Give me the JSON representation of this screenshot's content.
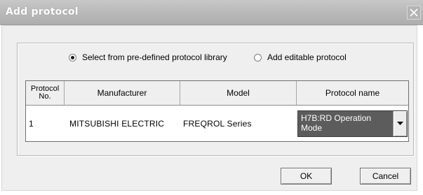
{
  "window": {
    "title": "Add protocol"
  },
  "options": {
    "predefined_label": "Select from pre-defined protocol library",
    "predefined_checked": true,
    "editable_label": "Add editable protocol",
    "editable_checked": false
  },
  "table": {
    "headers": {
      "protocol_no_line1": "Protocol",
      "protocol_no_line2": "No.",
      "manufacturer": "Manufacturer",
      "model": "Model",
      "protocol_name": "Protocol name"
    },
    "rows": [
      {
        "protocol_no": "1",
        "manufacturer": "MITSUBISHI ELECTRIC",
        "model": "FREQROL Series",
        "protocol_name_line1": "H7B:RD Operation",
        "protocol_name_line2": "Mode"
      }
    ]
  },
  "buttons": {
    "ok": "OK",
    "cancel": "Cancel"
  },
  "icons": {
    "close": "close-icon",
    "dropdown": "chevron-down-icon"
  },
  "colors": {
    "titlebar": "#b9b9b9",
    "selected_cell": "#5c5c5c",
    "dialog_bg": "#efefef"
  }
}
